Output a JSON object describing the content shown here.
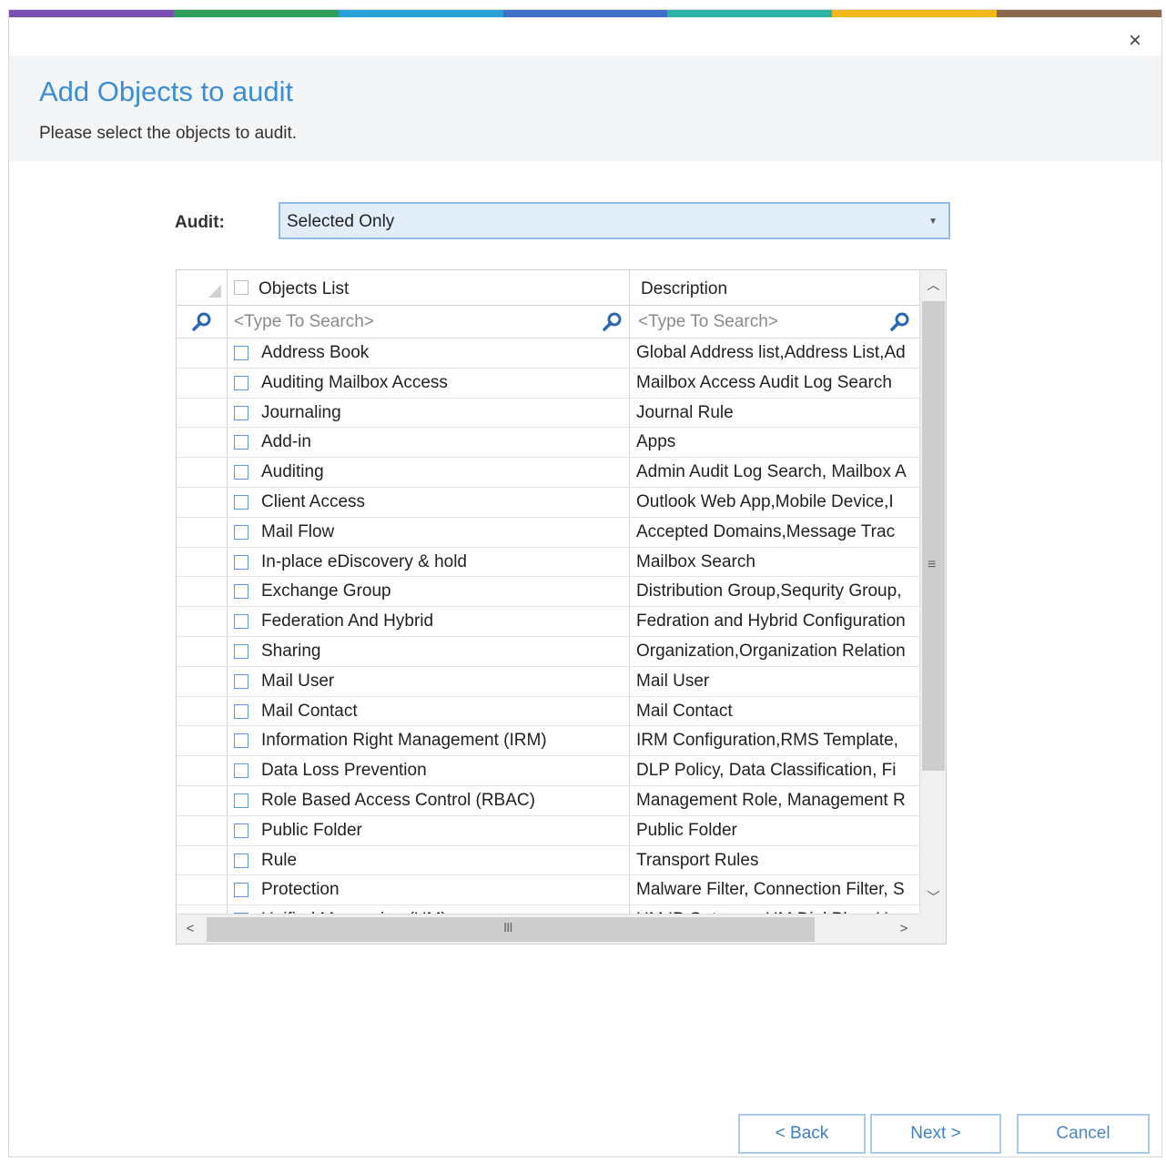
{
  "window": {
    "close_symbol": "×",
    "accent_colors": [
      "#7a4fb3",
      "#2e9e5b",
      "#27a1d6",
      "#3e6fc9",
      "#2cb3a3",
      "#f2b81c",
      "#8a6a4e"
    ]
  },
  "header": {
    "title": "Add Objects to audit",
    "subtitle": "Please select the objects to audit."
  },
  "audit": {
    "label": "Audit:",
    "selected": "Selected Only"
  },
  "grid": {
    "columns": {
      "objects": "Objects List",
      "description": "Description"
    },
    "search_placeholder_objects": "<Type To Search>",
    "search_placeholder_description": "<Type To Search>",
    "rows": [
      {
        "object": "Address Book",
        "description": "Global Address list,Address List,Ad"
      },
      {
        "object": "Auditing Mailbox Access",
        "description": "Mailbox Access Audit Log Search"
      },
      {
        "object": "Journaling",
        "description": "Journal Rule"
      },
      {
        "object": "Add-in",
        "description": "Apps"
      },
      {
        "object": "Auditing",
        "description": "Admin Audit Log Search, Mailbox A"
      },
      {
        "object": "Client Access",
        "description": "Outlook Web App,Mobile Device,I"
      },
      {
        "object": "Mail Flow",
        "description": "Accepted Domains,Message Trac"
      },
      {
        "object": "In-place eDiscovery & hold",
        "description": "Mailbox Search"
      },
      {
        "object": "Exchange Group",
        "description": "Distribution Group,Sequrity Group,"
      },
      {
        "object": "Federation And Hybrid",
        "description": "Fedration and Hybrid Configuration"
      },
      {
        "object": "Sharing",
        "description": "Organization,Organization Relation"
      },
      {
        "object": "Mail User",
        "description": "Mail User"
      },
      {
        "object": "Mail Contact",
        "description": "Mail Contact"
      },
      {
        "object": "Information Right Management (IRM)",
        "description": "IRM Configuration,RMS Template,"
      },
      {
        "object": "Data Loss Prevention",
        "description": "DLP Policy, Data Classification, Fi"
      },
      {
        "object": "Role Based Access Control (RBAC)",
        "description": "Management Role, Management R"
      },
      {
        "object": "Public Folder",
        "description": "Public Folder"
      },
      {
        "object": "Rule",
        "description": "Transport Rules"
      },
      {
        "object": "Protection",
        "description": "Malware Filter, Connection Filter, S"
      },
      {
        "object": "Unified Messaging (UM)",
        "description": "UM IP Gateway, UM Dial Plan, U"
      }
    ],
    "hscroll_grip": "III",
    "vscroll_grip": "≡"
  },
  "buttons": {
    "back": "< Back",
    "next": "Next >",
    "cancel": "Cancel"
  }
}
